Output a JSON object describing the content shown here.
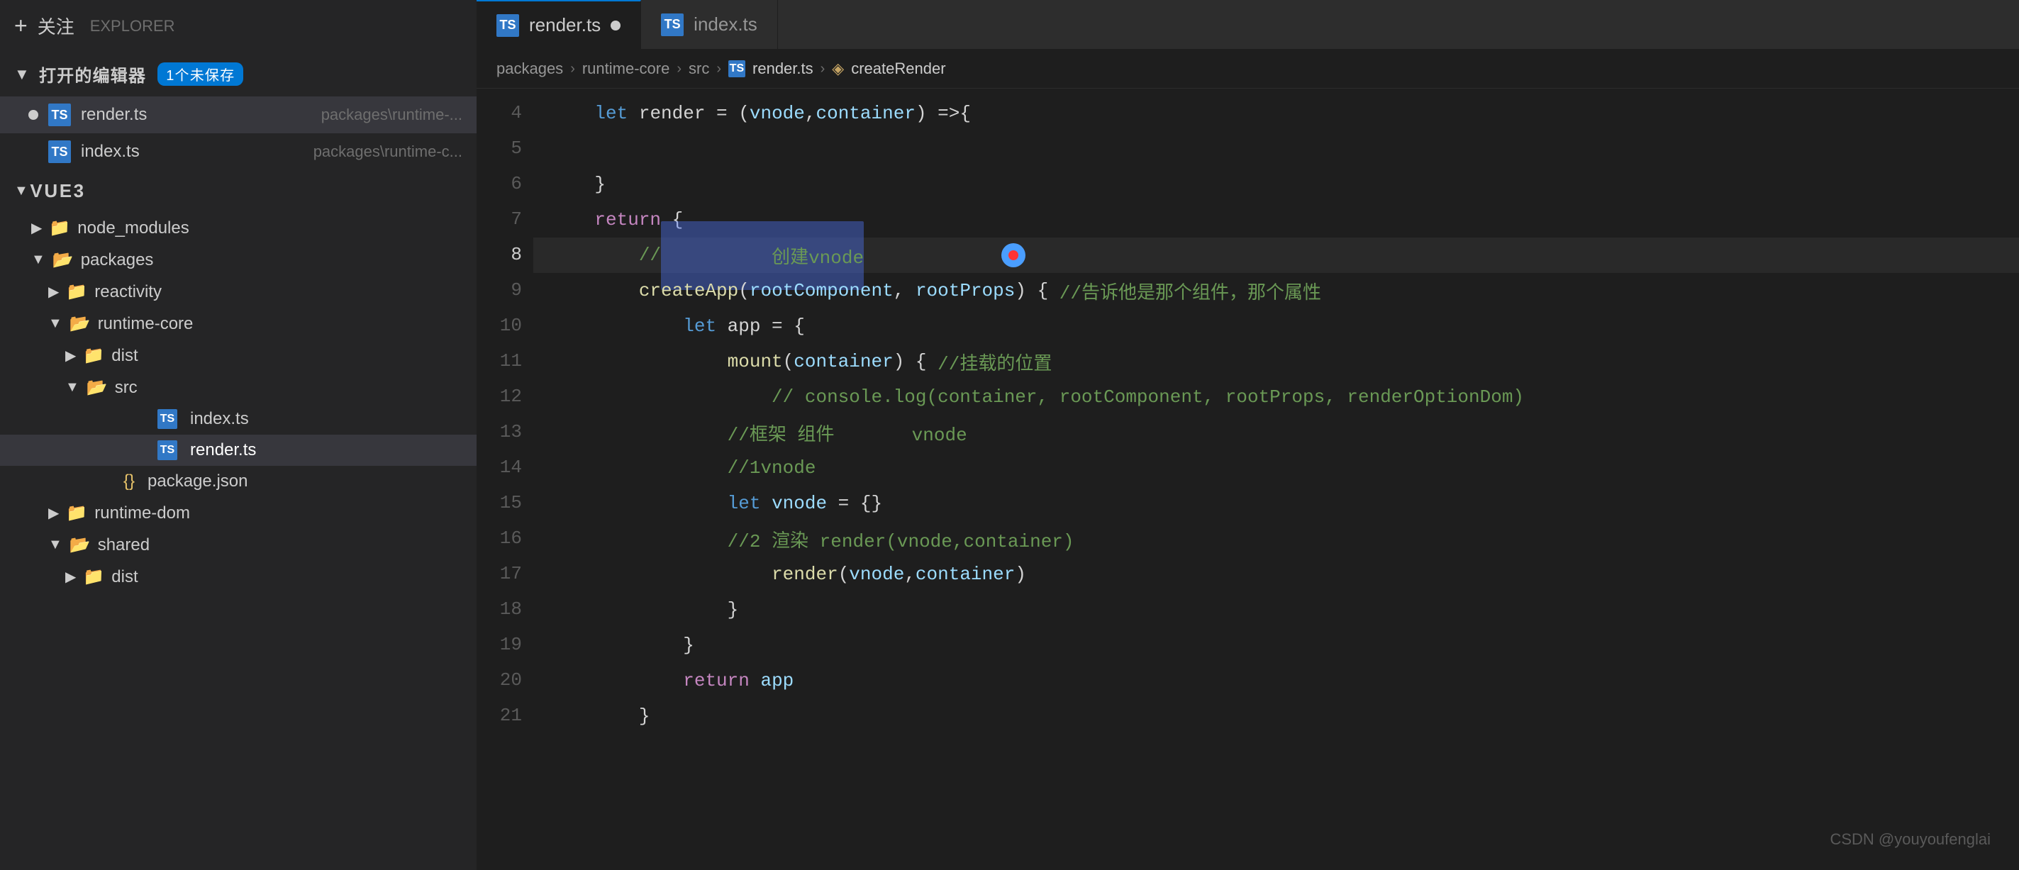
{
  "sidebar": {
    "header": {
      "add_label": "+",
      "title": "关注",
      "explorer_label": "EXPLORER"
    },
    "open_editors": {
      "section_label": "打开的编辑器",
      "badge": "1个未保存",
      "files": [
        {
          "id": "render-ts-open",
          "name": "render.ts",
          "path": "packages\\runtime-...",
          "lang": "TS",
          "modified": true
        },
        {
          "id": "index-ts-open",
          "name": "index.ts",
          "path": "packages\\runtime-c...",
          "lang": "TS",
          "modified": false
        }
      ]
    },
    "vue3_tree": {
      "section_label": "VUE3",
      "items": [
        {
          "id": "node_modules",
          "label": "node_modules",
          "type": "folder",
          "indent": 1,
          "expanded": false
        },
        {
          "id": "packages",
          "label": "packages",
          "type": "folder",
          "indent": 1,
          "expanded": true
        },
        {
          "id": "reactivity",
          "label": "reactivity",
          "type": "folder",
          "indent": 2,
          "expanded": false
        },
        {
          "id": "runtime-core",
          "label": "runtime-core",
          "type": "folder",
          "indent": 2,
          "expanded": true
        },
        {
          "id": "dist-core",
          "label": "dist",
          "type": "folder",
          "indent": 3,
          "expanded": false
        },
        {
          "id": "src",
          "label": "src",
          "type": "folder",
          "indent": 3,
          "expanded": true
        },
        {
          "id": "index-ts",
          "label": "index.ts",
          "type": "ts",
          "indent": 4
        },
        {
          "id": "render-ts",
          "label": "render.ts",
          "type": "ts",
          "indent": 4,
          "selected": true
        },
        {
          "id": "package-json",
          "label": "package.json",
          "type": "json",
          "indent": 3
        },
        {
          "id": "runtime-dom",
          "label": "runtime-dom",
          "type": "folder",
          "indent": 2,
          "expanded": false
        },
        {
          "id": "shared",
          "label": "shared",
          "type": "folder",
          "indent": 2,
          "expanded": true
        },
        {
          "id": "dist-shared",
          "label": "dist",
          "type": "folder",
          "indent": 3,
          "expanded": false
        }
      ]
    }
  },
  "tabs": [
    {
      "id": "render-ts-tab",
      "label": "render.ts",
      "lang": "TS",
      "active": true,
      "modified": true
    },
    {
      "id": "index-ts-tab",
      "label": "index.ts",
      "lang": "TS",
      "active": false,
      "modified": false
    }
  ],
  "breadcrumb": {
    "parts": [
      "packages",
      "runtime-core",
      "src",
      "render.ts",
      "createRender"
    ]
  },
  "code": {
    "lines": [
      {
        "num": 4,
        "content": "    let render = (vnode,container) =>{",
        "tokens": [
          {
            "text": "    ",
            "class": "plain"
          },
          {
            "text": "let",
            "class": "kw"
          },
          {
            "text": " render = (",
            "class": "plain"
          },
          {
            "text": "vnode",
            "class": "param"
          },
          {
            "text": ",",
            "class": "plain"
          },
          {
            "text": "container",
            "class": "param"
          },
          {
            "text": ") =>",
            "class": "plain"
          },
          {
            "text": "{",
            "class": "plain"
          }
        ]
      },
      {
        "num": 5,
        "content": "",
        "tokens": []
      },
      {
        "num": 6,
        "content": "    }",
        "tokens": [
          {
            "text": "    }",
            "class": "plain"
          }
        ]
      },
      {
        "num": 7,
        "content": "    return {",
        "tokens": [
          {
            "text": "    ",
            "class": "plain"
          },
          {
            "text": "return",
            "class": "kw2"
          },
          {
            "text": " {",
            "class": "plain"
          }
        ]
      },
      {
        "num": 8,
        "content": "        //创建vnode",
        "tokens": [
          {
            "text": "        //",
            "class": "comment"
          },
          {
            "text": "创建vnode",
            "class": "comment",
            "cursor": true
          }
        ],
        "has_cursor": true
      },
      {
        "num": 9,
        "content": "        createApp(rootComponent, rootProps) { //告诉他是那个组件，那个属性",
        "tokens": [
          {
            "text": "        ",
            "class": "plain"
          },
          {
            "text": "createApp",
            "class": "fn"
          },
          {
            "text": "(",
            "class": "plain"
          },
          {
            "text": "rootComponent",
            "class": "param"
          },
          {
            "text": ", ",
            "class": "plain"
          },
          {
            "text": "rootProps",
            "class": "param"
          },
          {
            "text": ") { ",
            "class": "plain"
          },
          {
            "text": "//告诉他是那个组件，那个属性",
            "class": "comment"
          }
        ]
      },
      {
        "num": 10,
        "content": "            let app = {",
        "tokens": [
          {
            "text": "            ",
            "class": "plain"
          },
          {
            "text": "let",
            "class": "kw"
          },
          {
            "text": " app = {",
            "class": "plain"
          }
        ]
      },
      {
        "num": 11,
        "content": "                mount(container) { //挂载的位置",
        "tokens": [
          {
            "text": "                ",
            "class": "plain"
          },
          {
            "text": "mount",
            "class": "fn"
          },
          {
            "text": "(",
            "class": "plain"
          },
          {
            "text": "container",
            "class": "param"
          },
          {
            "text": ") { ",
            "class": "plain"
          },
          {
            "text": "//挂载的位置",
            "class": "comment"
          }
        ]
      },
      {
        "num": 12,
        "content": "                    // console.log(container, rootComponent, rootProps, renderOptionDom)",
        "tokens": [
          {
            "text": "                    // console.log(container, rootComponent, rootProps, renderOptionDom)",
            "class": "comment"
          }
        ]
      },
      {
        "num": 13,
        "content": "                //框架 组件       vnode",
        "tokens": [
          {
            "text": "                //框架 组件       vnode",
            "class": "comment"
          }
        ]
      },
      {
        "num": 14,
        "content": "                //1vnode",
        "tokens": [
          {
            "text": "                //1vnode",
            "class": "comment"
          }
        ]
      },
      {
        "num": 15,
        "content": "                let vnode = {}",
        "tokens": [
          {
            "text": "                ",
            "class": "plain"
          },
          {
            "text": "let",
            "class": "kw"
          },
          {
            "text": " ",
            "class": "plain"
          },
          {
            "text": "vnode",
            "class": "var"
          },
          {
            "text": " = {}",
            "class": "plain"
          }
        ]
      },
      {
        "num": 16,
        "content": "                //2 渲染 render(vnode,container)",
        "tokens": [
          {
            "text": "                //2 渲染 render(vnode,container)",
            "class": "comment"
          }
        ]
      },
      {
        "num": 17,
        "content": "                    render(vnode,container)",
        "tokens": [
          {
            "text": "                    ",
            "class": "plain"
          },
          {
            "text": "render",
            "class": "fn"
          },
          {
            "text": "(",
            "class": "plain"
          },
          {
            "text": "vnode",
            "class": "var"
          },
          {
            "text": ",",
            "class": "plain"
          },
          {
            "text": "container",
            "class": "var"
          },
          {
            "text": ")",
            "class": "plain"
          }
        ]
      },
      {
        "num": 18,
        "content": "                }",
        "tokens": [
          {
            "text": "                }",
            "class": "plain"
          }
        ]
      },
      {
        "num": 19,
        "content": "            }",
        "tokens": [
          {
            "text": "            }",
            "class": "plain"
          }
        ]
      },
      {
        "num": 20,
        "content": "            return app",
        "tokens": [
          {
            "text": "            ",
            "class": "plain"
          },
          {
            "text": "return",
            "class": "kw2"
          },
          {
            "text": " ",
            "class": "plain"
          },
          {
            "text": "app",
            "class": "var"
          }
        ]
      },
      {
        "num": 21,
        "content": "        }",
        "tokens": [
          {
            "text": "        }",
            "class": "plain"
          }
        ]
      }
    ]
  },
  "watermark": "CSDN @youyoufenglai"
}
